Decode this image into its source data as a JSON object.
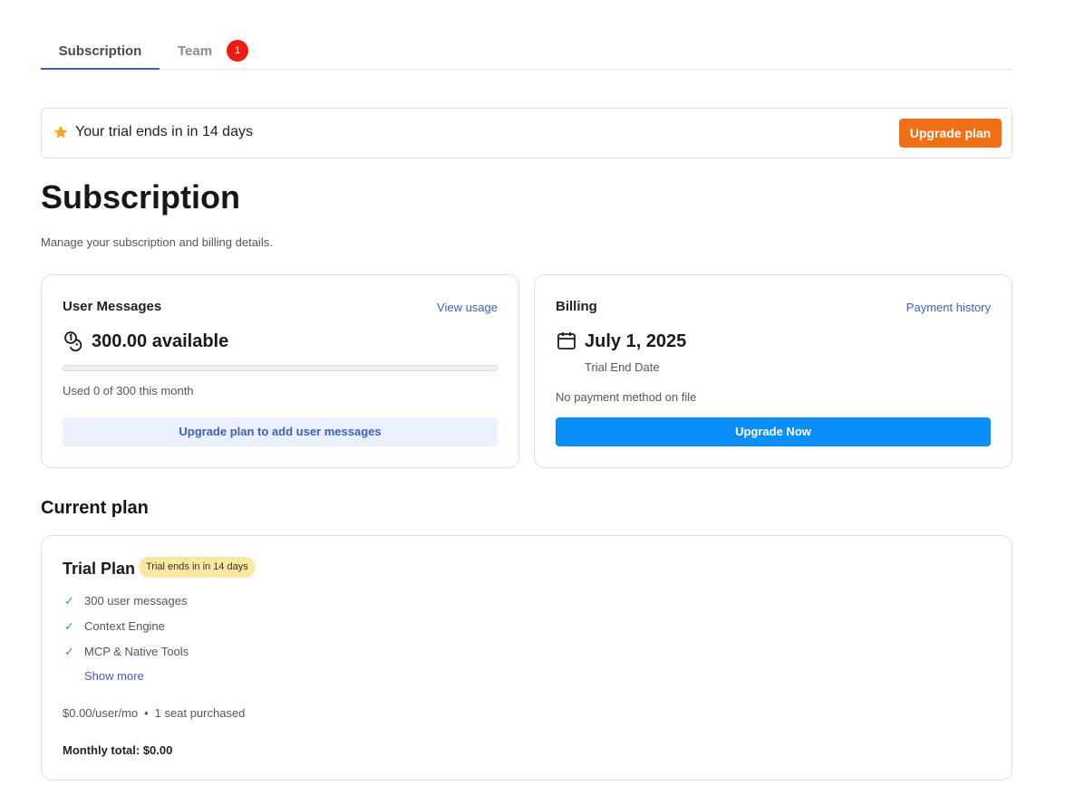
{
  "tabs": [
    {
      "label": "Subscription",
      "active": true
    },
    {
      "label": "Team",
      "active": false,
      "badge": "1"
    }
  ],
  "banner": {
    "icon": "star-icon",
    "text": "Your trial ends in in 14 days",
    "button_label": "Upgrade plan"
  },
  "page": {
    "title": "Subscription",
    "subtitle": "Manage your subscription and billing details."
  },
  "user_messages": {
    "title": "User Messages",
    "link": "View usage",
    "icon": "coins-icon",
    "value": "300.00 available",
    "used_fraction": 0,
    "usage_text": "Used 0 of 300 this month",
    "button_label": "Upgrade plan to add user messages"
  },
  "billing": {
    "title": "Billing",
    "link": "Payment history",
    "icon": "calendar-icon",
    "date": "July 1, 2025",
    "date_label": "Trial End Date",
    "payment_text": "No payment method on file",
    "button_label": "Upgrade Now"
  },
  "current_plan": {
    "section_title": "Current plan",
    "name": "Trial Plan",
    "badge": "Trial ends in in 14 days",
    "features": [
      "300 user messages",
      "Context Engine",
      "MCP & Native Tools"
    ],
    "show_more": "Show more",
    "price": "$0.00/user/mo",
    "separator": "•",
    "seats": "1 seat purchased",
    "total": "Monthly total: $0.00"
  },
  "colors": {
    "accent": "#3b63c4",
    "orange": "#f36f16",
    "primary_blue": "#0a8ef7",
    "badge_red": "#ef1b14",
    "trial_badge": "#fbe7a1",
    "check_green": "#2fa85a"
  }
}
